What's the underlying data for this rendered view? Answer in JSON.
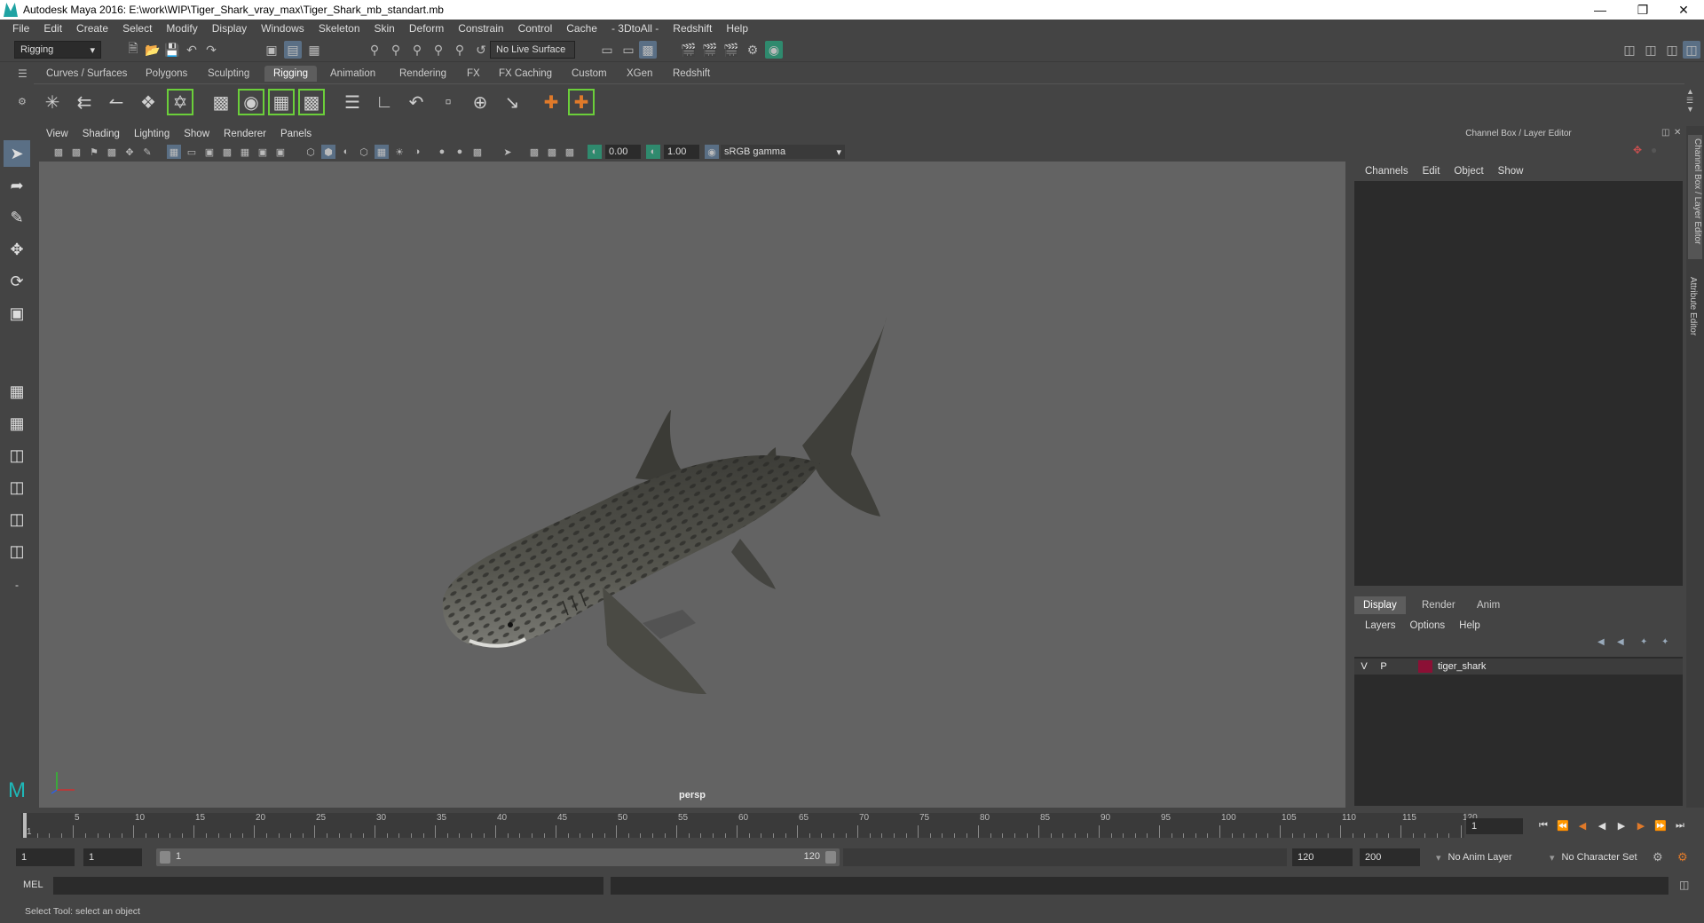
{
  "window": {
    "title": "Autodesk Maya 2016: E:\\work\\WIP\\Tiger_Shark_vray_max\\Tiger_Shark_mb_standart.mb"
  },
  "menubar": [
    "File",
    "Edit",
    "Create",
    "Select",
    "Modify",
    "Display",
    "Windows",
    "Skeleton",
    "Skin",
    "Deform",
    "Constrain",
    "Control",
    "Cache",
    "- 3DtoAll -",
    "Redshift",
    "Help"
  ],
  "statusline": {
    "mode": "Rigging",
    "live_surface": "No Live Surface"
  },
  "shelf_tabs": [
    "Curves / Surfaces",
    "Polygons",
    "Sculpting",
    "Rigging",
    "Animation",
    "Rendering",
    "FX",
    "FX Caching",
    "Custom",
    "XGen",
    "Redshift"
  ],
  "shelf_active": "Rigging",
  "viewport": {
    "menu": [
      "View",
      "Shading",
      "Lighting",
      "Show",
      "Renderer",
      "Panels"
    ],
    "exposure": "0.00",
    "gamma": "1.00",
    "color_space": "sRGB gamma",
    "camera": "persp"
  },
  "channel_box": {
    "title": "Channel Box / Layer Editor",
    "menu": [
      "Channels",
      "Edit",
      "Object",
      "Show"
    ]
  },
  "layer_editor": {
    "tabs": [
      "Display",
      "Render",
      "Anim"
    ],
    "active_tab": "Display",
    "menu": [
      "Layers",
      "Options",
      "Help"
    ],
    "layers": [
      {
        "v": "V",
        "p": "P",
        "name": "tiger_shark",
        "color": "#8b1035"
      }
    ]
  },
  "side_tabs": [
    "Channel Box / Layer Editor",
    "Attribute Editor"
  ],
  "timeline": {
    "ticks": [
      "1",
      "5",
      "10",
      "15",
      "20",
      "25",
      "30",
      "35",
      "40",
      "45",
      "50",
      "55",
      "60",
      "65",
      "70",
      "75",
      "80",
      "85",
      "90",
      "95",
      "100",
      "105",
      "110",
      "115",
      "120"
    ],
    "current_frame": "1"
  },
  "range": {
    "start": "1",
    "playback_start": "1",
    "slider_start": "1",
    "slider_end": "120",
    "playback_end": "120",
    "end": "200",
    "anim_layer": "No Anim Layer",
    "character_set": "No Character Set"
  },
  "command_line": {
    "language": "MEL"
  },
  "help_line": "Select Tool: select an object",
  "colors": {
    "accent": "#5a6f85",
    "shelf_highlight": "#6bcf3a",
    "layer_color": "#8b1035"
  }
}
